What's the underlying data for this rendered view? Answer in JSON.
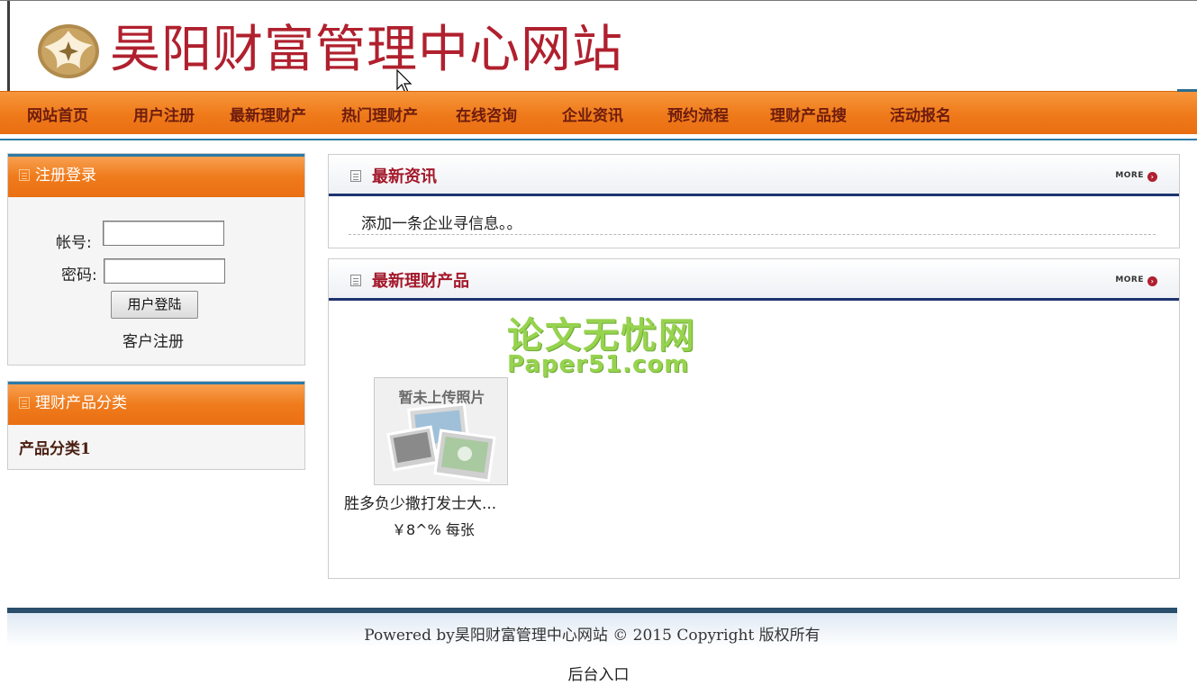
{
  "header": {
    "site_title": "昊阳财富管理中心网站",
    "logo_icon": "compass-emblem-icon"
  },
  "nav": {
    "items": [
      "网站首页",
      "用户注册",
      "最新理财产",
      "热门理财产",
      "在线咨询",
      "企业资讯",
      "预约流程",
      "理财产品搜",
      "活动报名"
    ]
  },
  "login": {
    "title": "注册登录",
    "account_label": "帐号:",
    "password_label": "密码:",
    "account_value": "",
    "password_value": "",
    "login_button": "用户登陆",
    "register_link": "客户注册"
  },
  "categories": {
    "title": "理财产品分类",
    "items": [
      "产品分类1"
    ]
  },
  "news": {
    "title": "最新资讯",
    "more": "MORE",
    "items": [
      "添加一条企业寻信息。。"
    ]
  },
  "products": {
    "title": "最新理财产品",
    "more": "MORE",
    "watermark_cn": "论文无忧网",
    "watermark_en": "Paper51.com",
    "items": [
      {
        "thumb_caption": "暂未上传照片",
        "name": "胜多负少撒打发士大...",
        "price": "￥8^% 每张"
      }
    ]
  },
  "footer": {
    "text": "Powered by昊阳财富管理中心网站 © 2015 Copyright  版权所有",
    "admin_link": "后台入口"
  },
  "colors": {
    "brand_red": "#b0202e",
    "nav_orange": "#ef7a1a",
    "accent_navy": "#1e3470",
    "watermark_green": "#8ccf3b"
  }
}
